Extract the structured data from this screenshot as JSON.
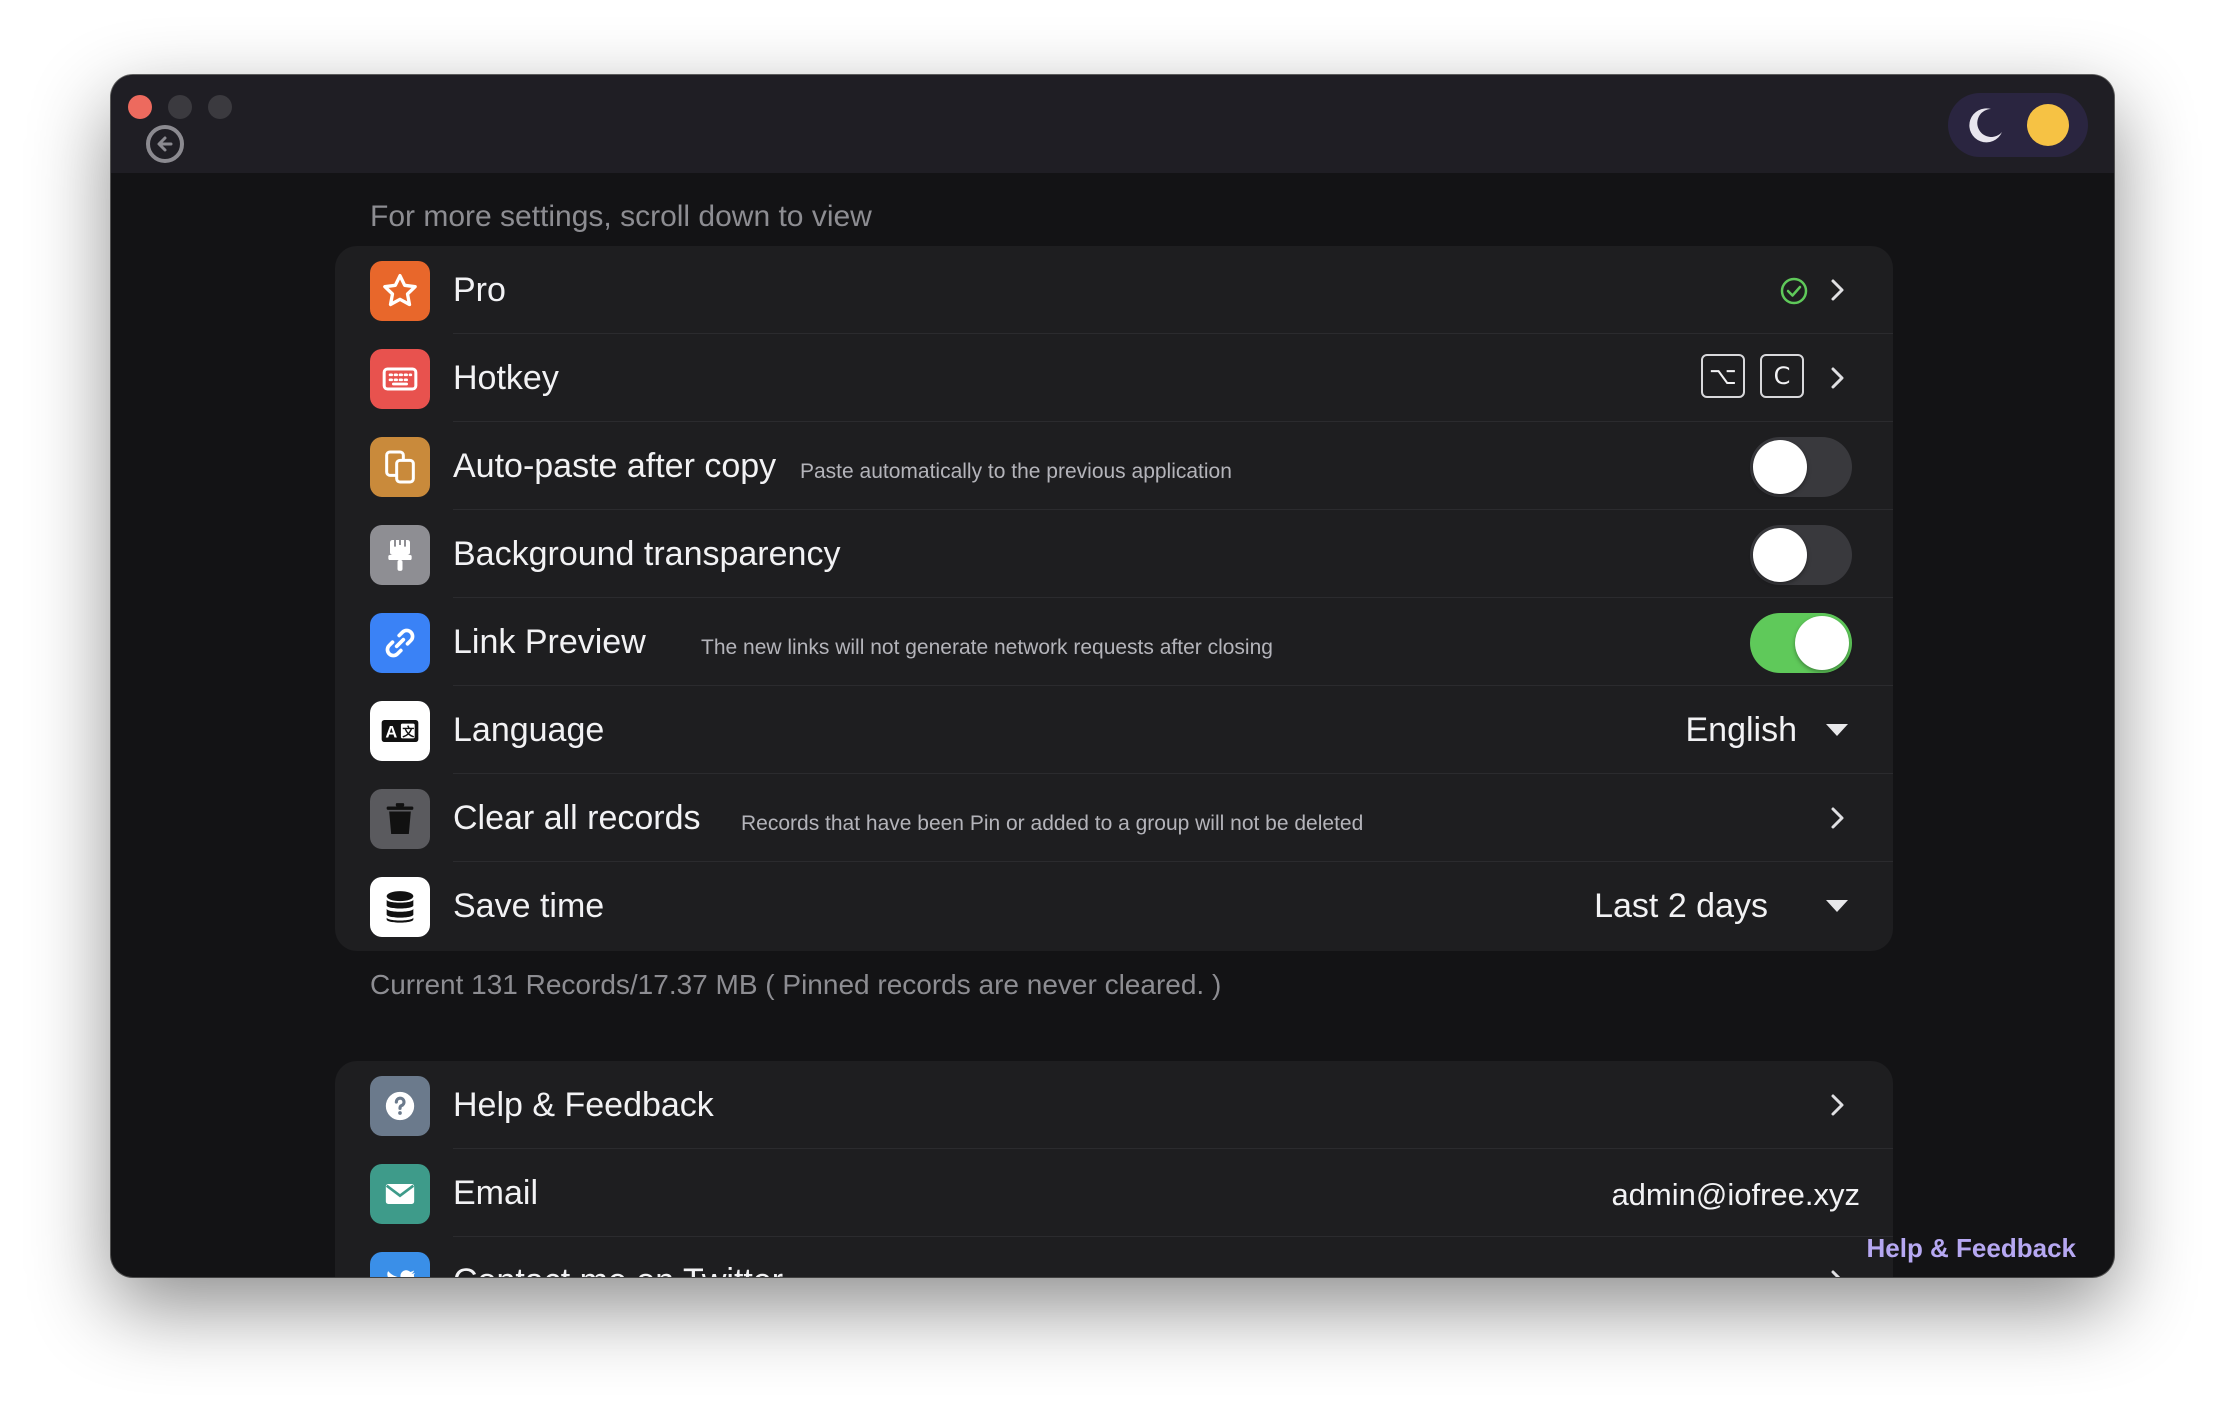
{
  "window": {
    "traffic_lights": [
      "close",
      "minimize",
      "maximize"
    ],
    "back_icon": "arrow-left-circle-icon",
    "theme_options": [
      "moon-icon",
      "sun-icon"
    ]
  },
  "hint": "For more settings, scroll down to view",
  "settings": [
    {
      "id": "pro",
      "label": "Pro",
      "icon": "star-icon",
      "icon_bg": "#e8672b",
      "status_icon": "check-circle-icon",
      "status_color": "#5fc95a"
    },
    {
      "id": "hotkey",
      "label": "Hotkey",
      "icon": "keyboard-icon",
      "icon_bg": "#e8524e",
      "keys": [
        "⌥",
        "C"
      ]
    },
    {
      "id": "auto-paste",
      "label": "Auto-paste after copy",
      "description": "Paste automatically to the previous application",
      "icon": "copy-icon",
      "icon_bg": "#c98a3b",
      "toggle": false
    },
    {
      "id": "background-transparency",
      "label": "Background transparency",
      "icon": "brush-icon",
      "icon_bg": "#8e8e93",
      "toggle": false
    },
    {
      "id": "link-preview",
      "label": "Link Preview",
      "description": "The new links will not generate network requests after closing",
      "icon": "link-icon",
      "icon_bg": "#3a82f6",
      "toggle": true
    },
    {
      "id": "language",
      "label": "Language",
      "icon": "translate-icon",
      "icon_bg": "#ffffff",
      "value": "English"
    },
    {
      "id": "clear-records",
      "label": "Clear all records",
      "description": "Records that have been Pin or added to a group will not be deleted",
      "icon": "trash-icon",
      "icon_bg": "#5a5a5e"
    },
    {
      "id": "save-time",
      "label": "Save time",
      "icon": "database-icon",
      "icon_bg": "#ffffff",
      "value": "Last 2 days"
    }
  ],
  "footnote": "Current 131 Records/17.37 MB  ( Pinned records are never cleared. )",
  "help": [
    {
      "id": "help-feedback",
      "label": "Help & Feedback",
      "icon": "question-icon",
      "icon_bg": "#6b7a8c"
    },
    {
      "id": "email",
      "label": "Email",
      "icon": "mail-icon",
      "icon_bg": "#3e9b8a",
      "value": "admin@iofree.xyz"
    },
    {
      "id": "twitter",
      "label": "Contact me on Twitter",
      "icon": "twitter-icon",
      "icon_bg": "#3a8fe8"
    }
  ],
  "floating_link": "Help & Feedback",
  "colors": {
    "accent_green": "#5fc95a",
    "link_purple": "#b6a8f2",
    "card_bg": "#1e1e20",
    "window_bg": "#131315"
  }
}
